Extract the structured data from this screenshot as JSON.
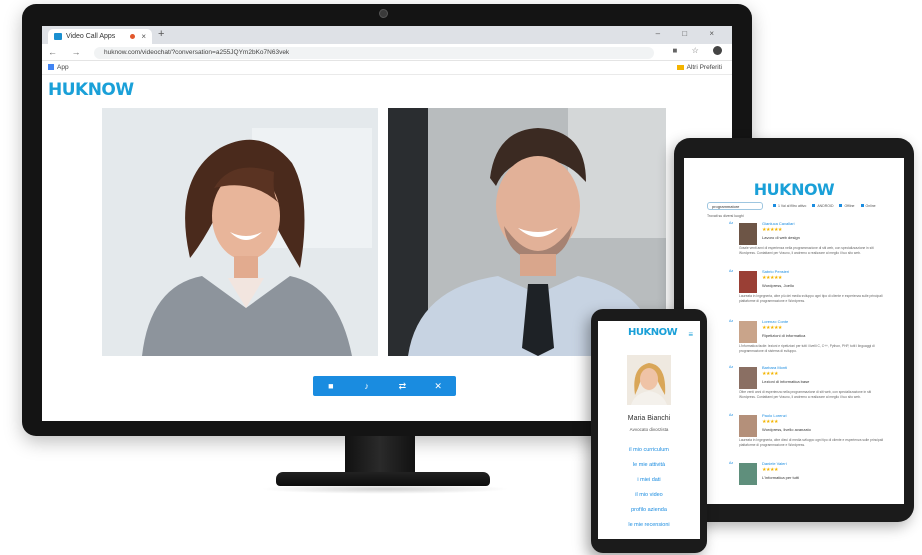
{
  "desktop": {
    "tab_title": "Video Call Apps",
    "tab_close": "×",
    "new_tab": "+",
    "window_controls": "–  □  ×",
    "nav_buttons": "← → C",
    "url": "huknow.com/videochat/?conversation=a255JQYm2bKo7N63vek",
    "addr_right": "■ ☆",
    "bookmark_apps": "App",
    "bookmark_other": "Altri Preferiti",
    "logo": "HUKNOW",
    "call_controls": [
      "■",
      "♪",
      "⇄",
      "✕"
    ],
    "call_control_icons": [
      "video-camera-icon",
      "microphone-icon",
      "switch-camera-icon",
      "hang-up-icon"
    ]
  },
  "tablet": {
    "logo": "HUKNOW",
    "search_value": "programmatore",
    "filters": [
      "1  Vai al filtro attivo",
      "ANDROID",
      "Offline",
      "Online"
    ],
    "result_count": "Trovati su diversi luoghi",
    "results": [
      {
        "label": "Az",
        "name": "Gianluca Cavallari",
        "stars": "★★★★★",
        "role": "Lavoro di web design",
        "desc": "Grazie venti anni di esperienza nella programmazione di siti web, con specializzazione in siti Wordpress. Contattami per Vrauno, li andremo a realizzare al meglio il tuo sito web."
      },
      {
        "label": "Az",
        "name": "Sabrio Pensieri",
        "stars": "★★★★★",
        "role": "Wordpress, Joello",
        "desc": "Laureata in Ingegneria, oltre più dei media sviluppo ogni tipo di cliente e esperienza sulle principali piattaforme di programmazione e Wordpress."
      },
      {
        "label": "Az",
        "name": "Lorenzo Conte",
        "stars": "★★★★★",
        "role": "Ripetizioni di informatica",
        "desc": "L'informatica facile: lezioni e ripetizioni per tutti i livelli C, C++, Python, PHP, tutti i linguaggi di programmazione di sistema di sviluppo."
      },
      {
        "label": "Az",
        "name": "Barbara Monti",
        "stars": "★★★★",
        "role": "Lezioni di informatica base",
        "desc": "Oltre venti anni di esperienza nella programmazione di siti web, con specializzazione in siti Wordpress. Contattami per Vrauno, li andremo a realizzare al meglio il tuo sito web."
      },
      {
        "label": "Az",
        "name": "Paolo Lorenzi",
        "stars": "★★★★",
        "role": "Wordpress, livello avanzato",
        "desc": "Laureata in Ingegneria, oltre dieci di media sviluppo ogni tipo di cliente e esperienza sulle principali piattaforme di programmazione e Wordpress."
      },
      {
        "label": "Az",
        "name": "Daniele Valeri",
        "stars": "★★★★",
        "role": "L'informatica per tutti",
        "desc": ""
      }
    ]
  },
  "phone": {
    "logo": "HUKNOW",
    "menu_icon": "≡",
    "name": "Maria Bianchi",
    "role": "Avvocato divorzista",
    "links": [
      "il mio curriculum",
      "le mie attività",
      "i miei dati",
      "il mio video",
      "profilo azienda",
      "le mie recensioni"
    ]
  }
}
